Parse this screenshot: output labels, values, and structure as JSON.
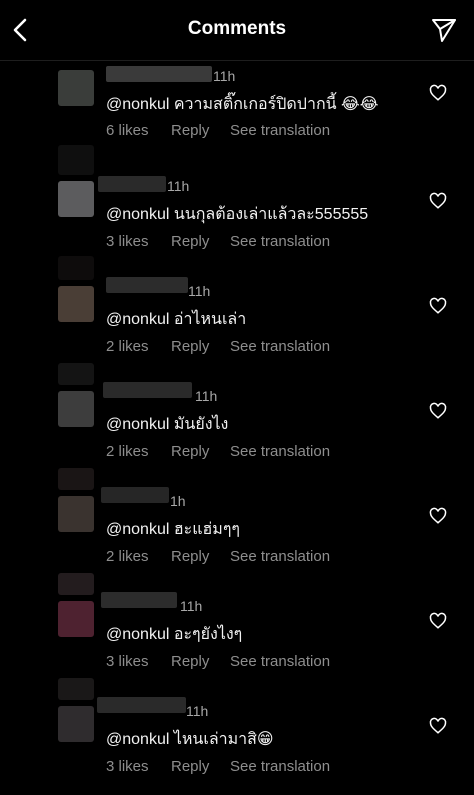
{
  "header": {
    "title": "Comments",
    "back_icon": "chevron-left-icon",
    "share_icon": "paper-plane-icon"
  },
  "comments": [
    {
      "time": "11h",
      "text": "@nonkul ความสติ๊กเกอร์ปิดปากนี้ 😂😂",
      "likes": "6 likes",
      "reply": "Reply",
      "translation": "See translation"
    },
    {
      "time": "11h",
      "text": "@nonkul นนกุลต้องเล่าแล้วละ555555",
      "likes": "3 likes",
      "reply": "Reply",
      "translation": "See translation"
    },
    {
      "time": "11h",
      "text": "@nonkul อ่าไหนเล่า",
      "likes": "2 likes",
      "reply": "Reply",
      "translation": "See translation"
    },
    {
      "time": "11h",
      "text": "@nonkul มันยังไง",
      "likes": "2 likes",
      "reply": "Reply",
      "translation": "See translation"
    },
    {
      "time": "1h",
      "text": "@nonkul ฮะแฮ่มๆๆ",
      "likes": "2 likes",
      "reply": "Reply",
      "translation": "See translation"
    },
    {
      "time": "11h",
      "text": "@nonkul อะๆยังไงๆ",
      "likes": "3 likes",
      "reply": "Reply",
      "translation": "See translation"
    },
    {
      "time": "11h",
      "text": "@nonkul ไหนเล่ามาสิ😁",
      "likes": "3 likes",
      "reply": "Reply",
      "translation": "See translation"
    }
  ]
}
